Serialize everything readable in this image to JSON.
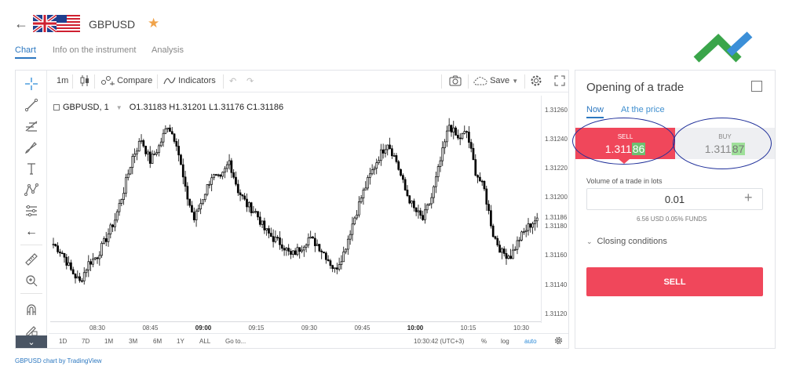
{
  "header": {
    "title": "GBPUSD"
  },
  "tabs": [
    {
      "label": "Chart",
      "active": true
    },
    {
      "label": "Info on the instrument",
      "active": false
    },
    {
      "label": "Analysis",
      "active": false
    }
  ],
  "toolbar": {
    "interval": "1m",
    "compare": "Compare",
    "indicators": "Indicators",
    "save": "Save"
  },
  "legend": {
    "symbol": "GBPUSD, 1",
    "ohlc": "O1.31183  H1.31201  L1.31176  C1.31186"
  },
  "chart_data": {
    "type": "candlestick",
    "y_ticks": [
      "1.31260",
      "1.31240",
      "1.31220",
      "1.31200",
      "1.31186",
      "1.31180",
      "1.31160",
      "1.31140",
      "1.31120"
    ],
    "ylim": [
      1.31115,
      1.3127
    ],
    "x_ticks": [
      {
        "label": "08:30",
        "bold": false
      },
      {
        "label": "08:45",
        "bold": false
      },
      {
        "label": "09:00",
        "bold": true
      },
      {
        "label": "09:15",
        "bold": false
      },
      {
        "label": "09:30",
        "bold": false
      },
      {
        "label": "09:45",
        "bold": false
      },
      {
        "label": "10:00",
        "bold": true
      },
      {
        "label": "10:15",
        "bold": false
      },
      {
        "label": "10:30",
        "bold": false
      }
    ],
    "path": [
      1.31168,
      1.31162,
      1.3115,
      1.31142,
      1.31155,
      1.3116,
      1.31172,
      1.31185,
      1.31205,
      1.31228,
      1.3124,
      1.31225,
      1.31235,
      1.3125,
      1.31238,
      1.31205,
      1.31185,
      1.312,
      1.31215,
      1.31212,
      1.31225,
      1.31205,
      1.31195,
      1.3119,
      1.31178,
      1.31172,
      1.31168,
      1.3116,
      1.31165,
      1.31172,
      1.31168,
      1.3116,
      1.3115,
      1.31162,
      1.31182,
      1.312,
      1.31215,
      1.31228,
      1.31238,
      1.31225,
      1.31205,
      1.31192,
      1.31185,
      1.312,
      1.31225,
      1.3125,
      1.3124,
      1.31245,
      1.31218,
      1.31205,
      1.31175,
      1.31162,
      1.3116,
      1.31172,
      1.3118,
      1.31186
    ]
  },
  "bottom_bar": {
    "ranges": [
      "1D",
      "7D",
      "1M",
      "3M",
      "6M",
      "1Y",
      "ALL"
    ],
    "goto": "Go to...",
    "time": "10:30:42 (UTC+3)",
    "percent": "%",
    "log": "log",
    "auto": "auto"
  },
  "credit": "GBPUSD chart by TradingView",
  "panel": {
    "title": "Opening of a trade",
    "tabs": [
      {
        "label": "Now",
        "active": true
      },
      {
        "label": "At the price",
        "active": false
      }
    ],
    "sell": {
      "label": "SELL",
      "price_main": "1.311",
      "price_hl": "86"
    },
    "buy": {
      "label": "BUY",
      "price_main": "1.311",
      "price_hl": "87"
    },
    "volume_label": "Volume of a trade in lots",
    "volume_value": "0.01",
    "volume_info": "6.56 USD  0.05% FUNDS",
    "closing": "Closing conditions",
    "sell_button": "SELL"
  },
  "colors": {
    "accent": "#2b77c0",
    "sell": "#f0475b",
    "star": "#f0a34a",
    "highlight_sell": "#6ec070",
    "highlight_buy": "#9fe09a",
    "annotation": "#1f2f9a"
  }
}
